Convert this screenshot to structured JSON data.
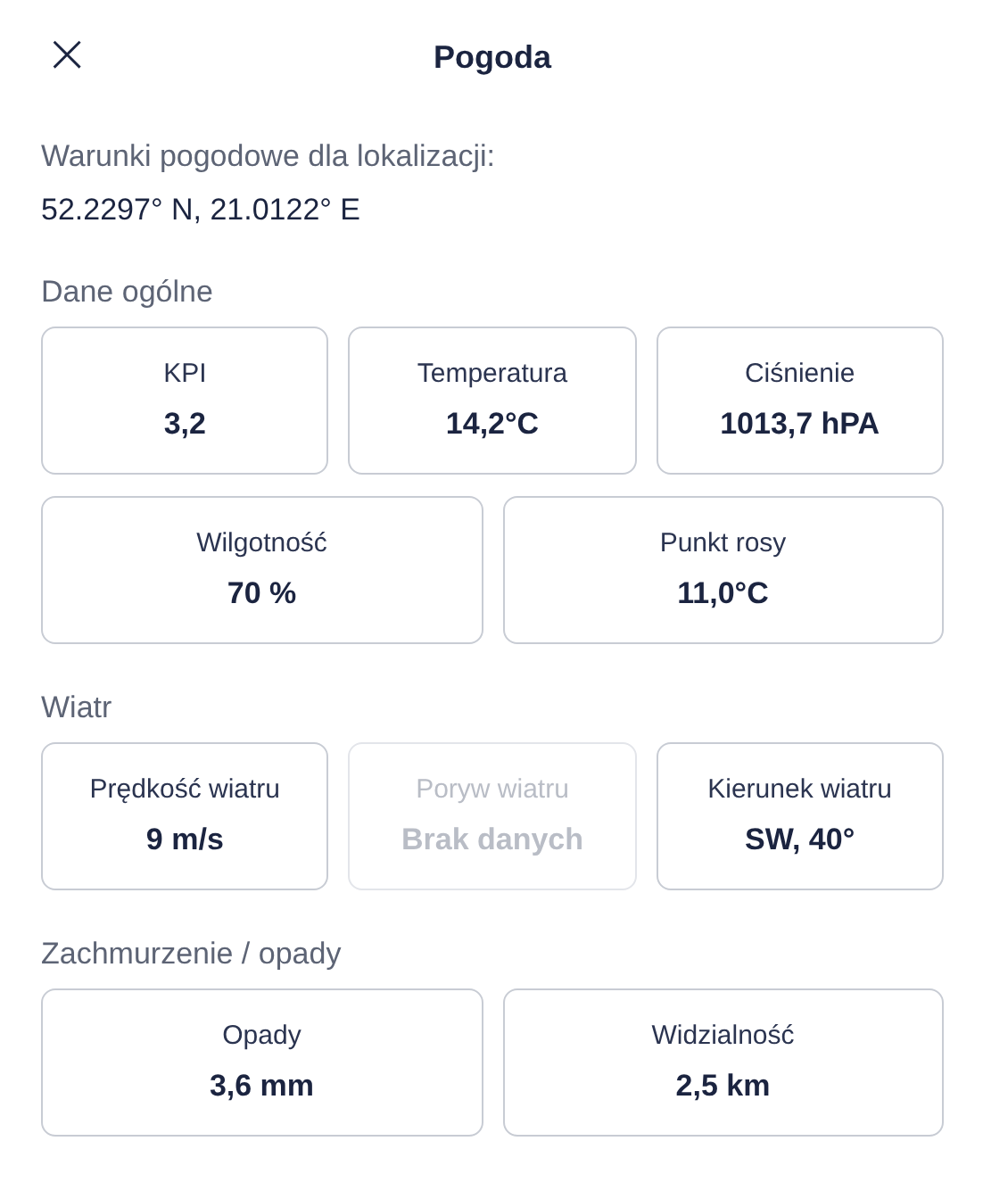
{
  "header": {
    "close_icon": "×",
    "title": "Pogoda"
  },
  "location": {
    "label": "Warunki pogodowe dla lokalizacji:",
    "coordinates": "52.2297° N, 21.0122° E"
  },
  "sections": [
    {
      "title": "Dane ogólne",
      "rows": [
        [
          {
            "label": "KPI",
            "value": "3,2",
            "disabled": false
          },
          {
            "label": "Temperatura",
            "value": "14,2°C",
            "disabled": false
          },
          {
            "label": "Ciśnienie",
            "value": "1013,7 hPA",
            "disabled": false
          }
        ],
        [
          {
            "label": "Wilgotność",
            "value": "70 %",
            "disabled": false
          },
          {
            "label": "Punkt rosy",
            "value": "11,0°C",
            "disabled": false
          }
        ]
      ]
    },
    {
      "title": "Wiatr",
      "rows": [
        [
          {
            "label": "Prędkość wiatru",
            "value": "9 m/s",
            "disabled": false
          },
          {
            "label": "Poryw wiatru",
            "value": "Brak danych",
            "disabled": true
          },
          {
            "label": "Kierunek wiatru",
            "value": "SW, 40°",
            "disabled": false
          }
        ]
      ]
    },
    {
      "title": "Zachmurzenie / opady",
      "rows": [
        [
          {
            "label": "Opady",
            "value": "3,6 mm",
            "disabled": false
          },
          {
            "label": "Widzialność",
            "value": "2,5 km",
            "disabled": false
          }
        ]
      ]
    }
  ]
}
